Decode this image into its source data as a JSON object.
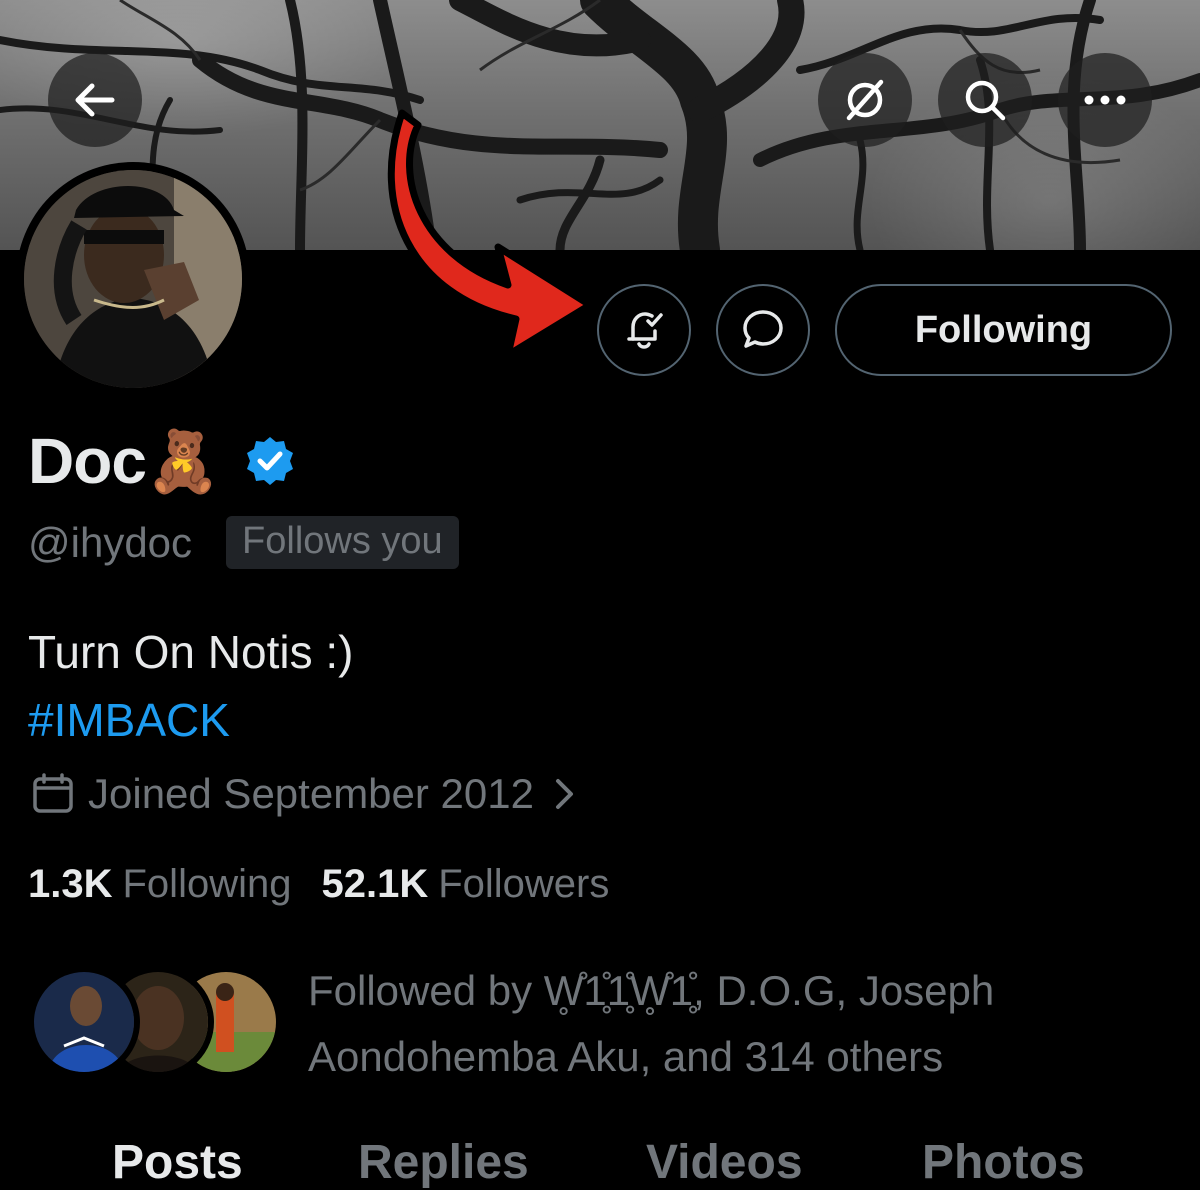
{
  "header": {
    "back_icon": "arrow-left-icon",
    "grok_icon": "slash-circle-icon",
    "search_icon": "search-icon",
    "more_icon": "more-horizontal-icon"
  },
  "actions": {
    "notify_icon": "bell-check-icon",
    "message_icon": "message-bubble-icon",
    "follow_label": "Following"
  },
  "profile": {
    "name": "Doc",
    "name_emoji": "🧸",
    "verified": true,
    "handle": "@ihydoc",
    "follows_you": "Follows you",
    "bio_line": "Turn On Notis :)",
    "hashtag": "#IMBACK",
    "joined": "Joined September 2012",
    "following_count": "1.3K",
    "following_label": "Following",
    "followers_count": "52.1K",
    "followers_label": "Followers",
    "followed_by_line1": "Followed by W̥̊1̥̊1̥̊W̥̊1̥̊, D.O.G, Joseph",
    "followed_by_line2": "Aondohemba Aku, and 314 others"
  },
  "tabs": [
    {
      "label": "Posts",
      "active": true
    },
    {
      "label": "Replies",
      "active": false
    },
    {
      "label": "Videos",
      "active": false
    },
    {
      "label": "Photos",
      "active": false
    }
  ],
  "colors": {
    "accent": "#1d9bf0",
    "muted": "#71767b",
    "annotation_arrow": "#e0281c"
  }
}
